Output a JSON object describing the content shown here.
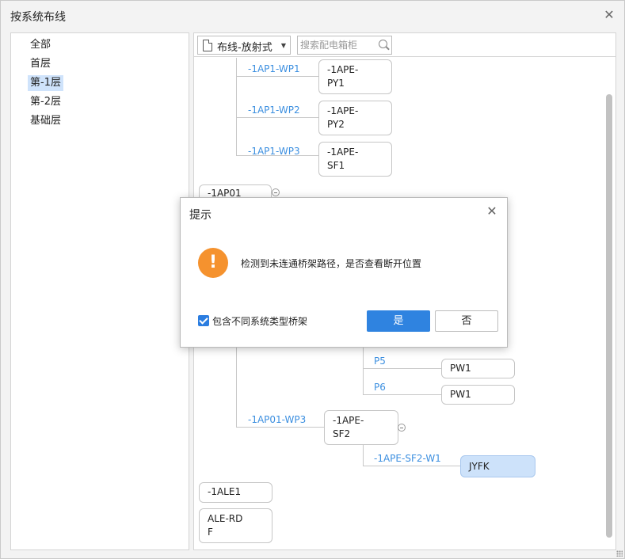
{
  "window": {
    "title": "按系统布线",
    "close_icon": "close-icon"
  },
  "floors": [
    "全部",
    "首层",
    "第-1层",
    "第-2层",
    "基础层"
  ],
  "selected_floor": "第-1层",
  "toolbar": {
    "mode_value": "布线-放射式",
    "search_placeholder": "搜索配电箱柜"
  },
  "tree": {
    "branch1": [
      {
        "link": "-1AP1-WP1",
        "node": [
          "-1APE-",
          "PY1"
        ]
      },
      {
        "link": "-1AP1-WP2",
        "node": [
          "-1APE-",
          "PY2"
        ]
      },
      {
        "link": "-1AP1-WP3",
        "node": [
          "-1APE-",
          "SF1"
        ]
      }
    ],
    "parent_node": "-1AP01",
    "p_links": [
      {
        "link": "P5",
        "node": "PW1"
      },
      {
        "link": "P6",
        "node": "PW1"
      }
    ],
    "wp3": {
      "link": "-1AP01-WP3",
      "node": [
        "-1APE-",
        "SF2"
      ]
    },
    "w1": {
      "link": "-1APE-SF2-W1",
      "node": "JYFK"
    },
    "ale_node": "-1ALE1",
    "ale_rdf": [
      "ALE-RD",
      "F"
    ]
  },
  "dialog": {
    "title": "提示",
    "message": "检测到未连通桥架路径，是否查看断开位置",
    "icon": "warning-icon",
    "checkbox_label": "包含不同系统类型桥架",
    "checkbox_checked": true,
    "yes_label": "是",
    "no_label": "否"
  },
  "colors": {
    "accent": "#2f83e0",
    "link": "#3c8fe0",
    "warning": "#f5922e",
    "highlight": "#cde2fa"
  }
}
